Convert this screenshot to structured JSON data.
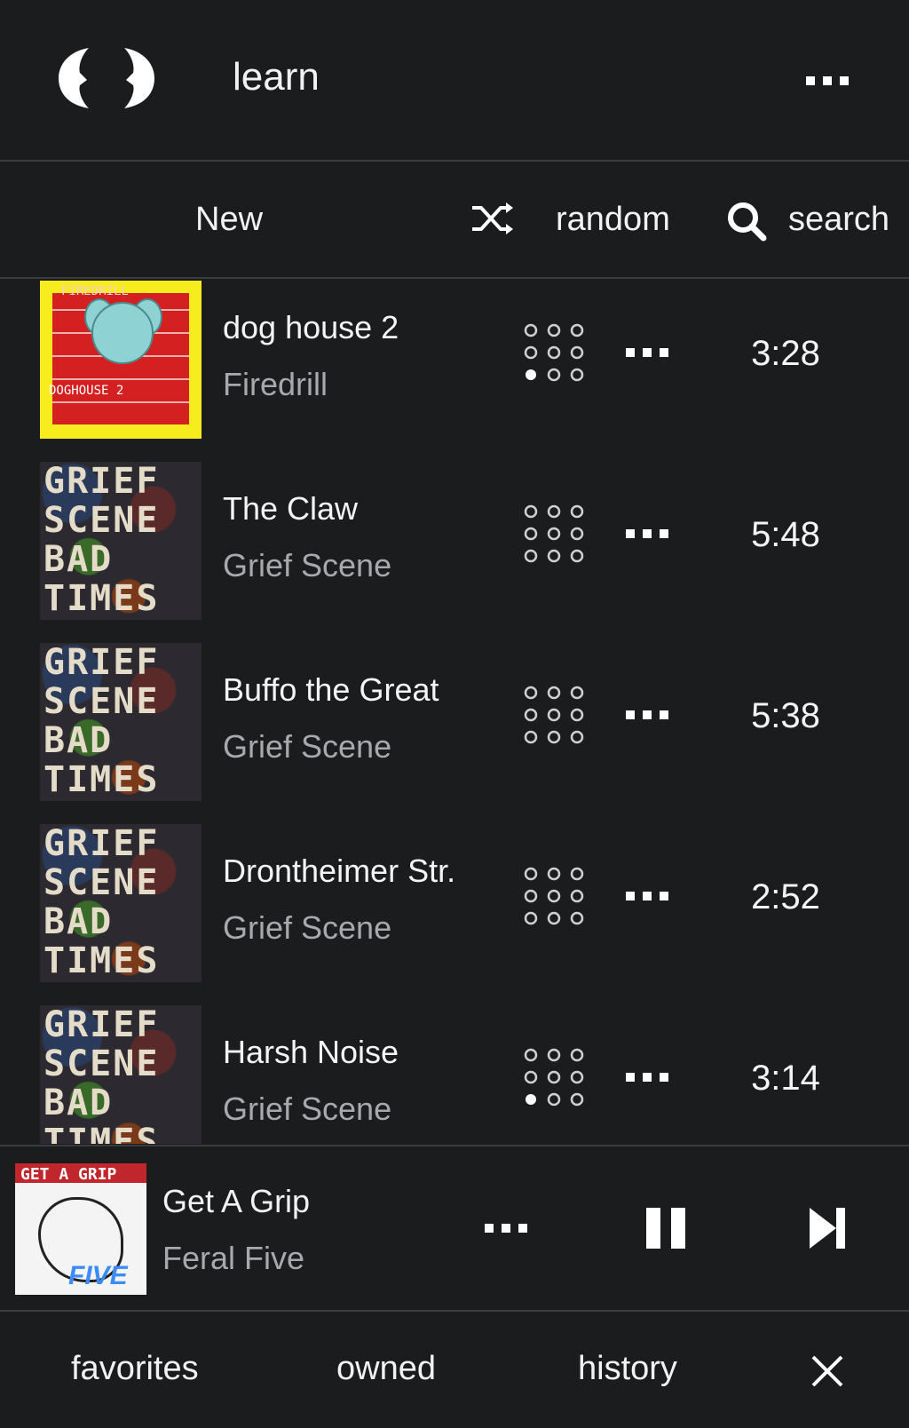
{
  "header": {
    "title": "learn"
  },
  "tabs": {
    "new": "New",
    "random": "random",
    "search": "search"
  },
  "tracks": [
    {
      "title": "dog house 2",
      "artist": "Firedrill",
      "duration": "3:28",
      "art": "firedrill",
      "active_dot": 6
    },
    {
      "title": "The Claw",
      "artist": "Grief Scene",
      "duration": "5:48",
      "art": "grief",
      "active_dot": -1
    },
    {
      "title": "Buffo the Great",
      "artist": "Grief Scene",
      "duration": "5:38",
      "art": "grief",
      "active_dot": -1
    },
    {
      "title": "Drontheimer Str.",
      "artist": "Grief Scene",
      "duration": "2:52",
      "art": "grief",
      "active_dot": -1
    },
    {
      "title": "Harsh Noise",
      "artist": "Grief Scene",
      "duration": "3:14",
      "art": "grief",
      "active_dot": 6
    }
  ],
  "art_text": {
    "firedrill_top": "FIREDRILL",
    "firedrill_bottom": "DOGHOUSE 2",
    "grief_lines": "GRIEF\nSCENE\nBAD\nTIMES"
  },
  "now_playing": {
    "title": "Get A Grip",
    "artist": "Feral Five",
    "art_top": "GET A GRIP",
    "art_bottom": "FIVE",
    "state": "playing"
  },
  "bottom_tabs": {
    "favorites": "favorites",
    "owned": "owned",
    "history": "history"
  },
  "colors": {
    "background": "#1b1c1e",
    "text": "#f2f2f2",
    "muted": "#a7a9ac",
    "divider": "#3a3c3f"
  }
}
